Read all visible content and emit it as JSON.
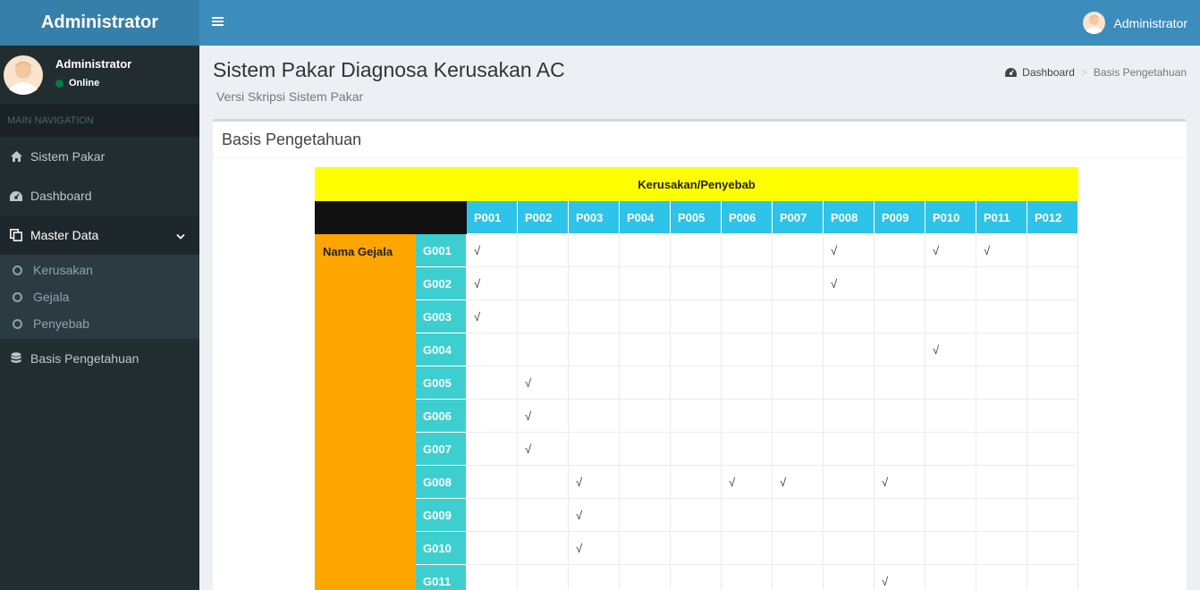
{
  "sidebar": {
    "logo": "Administrator",
    "user": {
      "name": "Administrator",
      "status": "Online"
    },
    "nav_header": "MAIN NAVIGATION",
    "items": [
      {
        "label": "Sistem Pakar",
        "icon": "home-icon"
      },
      {
        "label": "Dashboard",
        "icon": "dashboard-icon"
      },
      {
        "label": "Master Data",
        "icon": "copy-icon"
      },
      {
        "label": "Basis Pengetahuan",
        "icon": "database-icon"
      }
    ],
    "submenu": [
      {
        "label": "Kerusakan",
        "icon": "circle-icon"
      },
      {
        "label": "Gejala",
        "icon": "circle-icon"
      },
      {
        "label": "Penyebab",
        "icon": "circle-icon"
      }
    ]
  },
  "header": {
    "user_name": "Administrator"
  },
  "page": {
    "title": "Sistem Pakar Diagnosa Kerusakan AC",
    "subtitle": "Versi Skripsi Sistem Pakar",
    "breadcrumb": [
      "Dashboard",
      "Basis Pengetahuan"
    ]
  },
  "box": {
    "title": "Basis Pengetahuan",
    "table": {
      "caption": "Kerusakan/Penyebab",
      "row_header": "Nama Gejala",
      "check": "√",
      "columns": [
        "P001",
        "P002",
        "P003",
        "P004",
        "P005",
        "P006",
        "P007",
        "P008",
        "P009",
        "P010",
        "P011",
        "P012"
      ],
      "rows": [
        {
          "code": "G001",
          "checks": [
            "P001",
            "P008",
            "P010",
            "P011"
          ]
        },
        {
          "code": "G002",
          "checks": [
            "P001",
            "P008"
          ]
        },
        {
          "code": "G003",
          "checks": [
            "P001"
          ]
        },
        {
          "code": "G004",
          "checks": [
            "P010"
          ]
        },
        {
          "code": "G005",
          "checks": [
            "P002"
          ]
        },
        {
          "code": "G006",
          "checks": [
            "P002"
          ]
        },
        {
          "code": "G007",
          "checks": [
            "P002"
          ]
        },
        {
          "code": "G008",
          "checks": [
            "P003",
            "P006",
            "P007",
            "P009"
          ]
        },
        {
          "code": "G009",
          "checks": [
            "P003"
          ]
        },
        {
          "code": "G010",
          "checks": [
            "P003"
          ]
        },
        {
          "code": "G011",
          "checks": [
            "P009"
          ]
        }
      ]
    }
  },
  "colors": {
    "sidebar_bg": "#222d32",
    "header_bg": "#3c8dbc",
    "logo_bg": "#367fa9",
    "caption_bg": "#ffff00",
    "column_header_bg": "#2ec3e8",
    "row_label_bg": "#ffa500",
    "row_code_bg": "#3dcfcf"
  }
}
